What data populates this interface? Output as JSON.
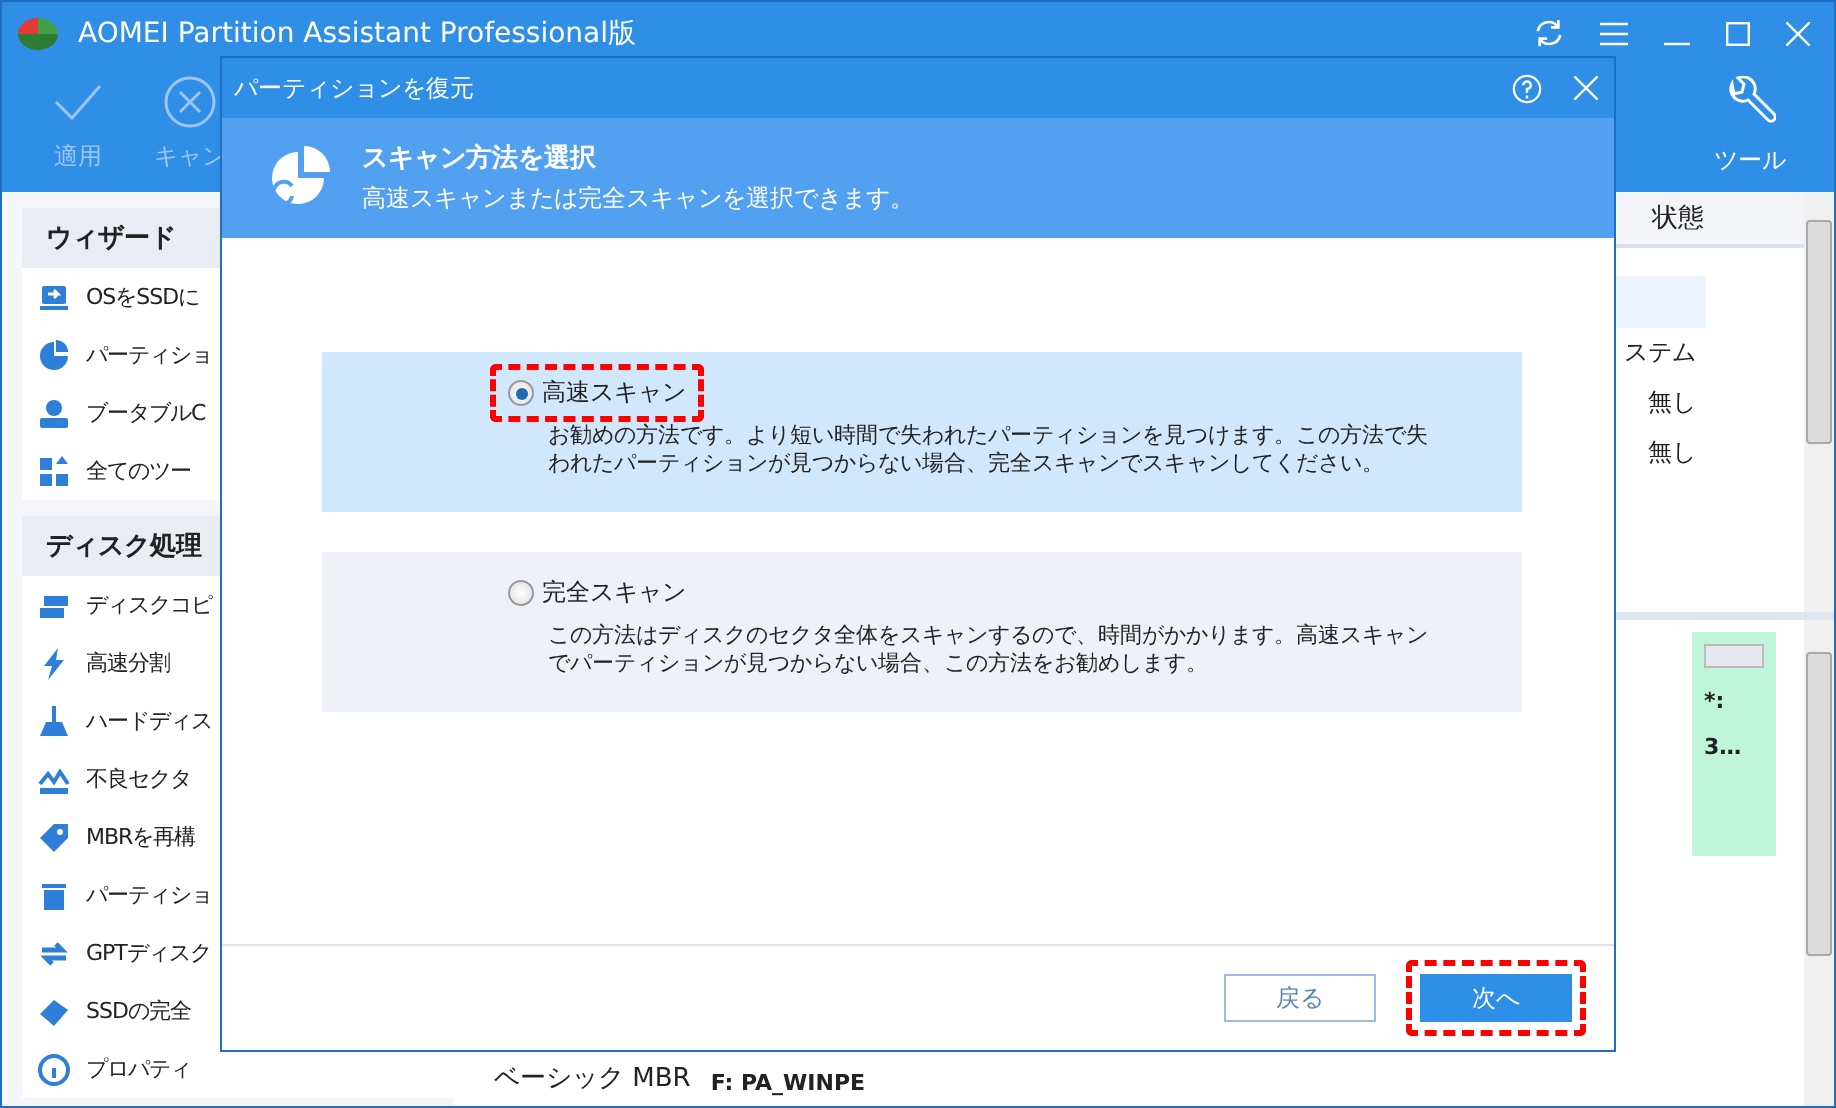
{
  "window": {
    "title": "AOMEI Partition Assistant Professional版"
  },
  "toolbar": [
    {
      "label": "適用",
      "disabled": true
    },
    {
      "label": "キャン",
      "disabled": true
    }
  ],
  "tools_button": {
    "label": "ツール"
  },
  "sidebar": {
    "sections": [
      {
        "title": "ウィザード",
        "items": [
          "OSをSSDに",
          "パーティショ",
          "ブータブルC",
          "全てのツー"
        ]
      },
      {
        "title": "ディスク処理",
        "items": [
          "ディスクコピ",
          "高速分割",
          "ハードディス",
          "不良セクタ",
          "MBRを再構",
          "パーティショ",
          "GPTディスク",
          "SSDの完全",
          "プロパティ"
        ]
      }
    ]
  },
  "partition_table": {
    "columns": [
      "状態"
    ],
    "rows": [
      {
        "status": "ステム"
      },
      {
        "status": "無し"
      },
      {
        "status": "無し"
      }
    ]
  },
  "disk_map": {
    "drive_letter": "*:",
    "size": "3…",
    "disk_type": "ベーシック MBR",
    "partition": "F: PA_WINPE"
  },
  "dialog": {
    "title": "パーティションを復元",
    "header_title": "スキャン方法を選択",
    "header_subtitle": "高速スキャンまたは完全スキャンを選択できます。",
    "options": [
      {
        "label": "高速スキャン",
        "description": "お勧めの方法です。より短い時間で失われたパーティションを見つけます。この方法で失われたパーティションが見つからない場合、完全スキャンでスキャンしてください。",
        "selected": true,
        "highlighted": true
      },
      {
        "label": "完全スキャン",
        "description": "この方法はディスクのセクタ全体をスキャンするので、時間がかかります。高速スキャンでパーティションが見つからない場合、この方法をお勧めします。",
        "selected": false,
        "highlighted": false
      }
    ],
    "buttons": [
      {
        "label": "戻る",
        "kind": "secondary",
        "highlighted": false
      },
      {
        "label": "次へ",
        "kind": "primary",
        "highlighted": true
      }
    ]
  }
}
